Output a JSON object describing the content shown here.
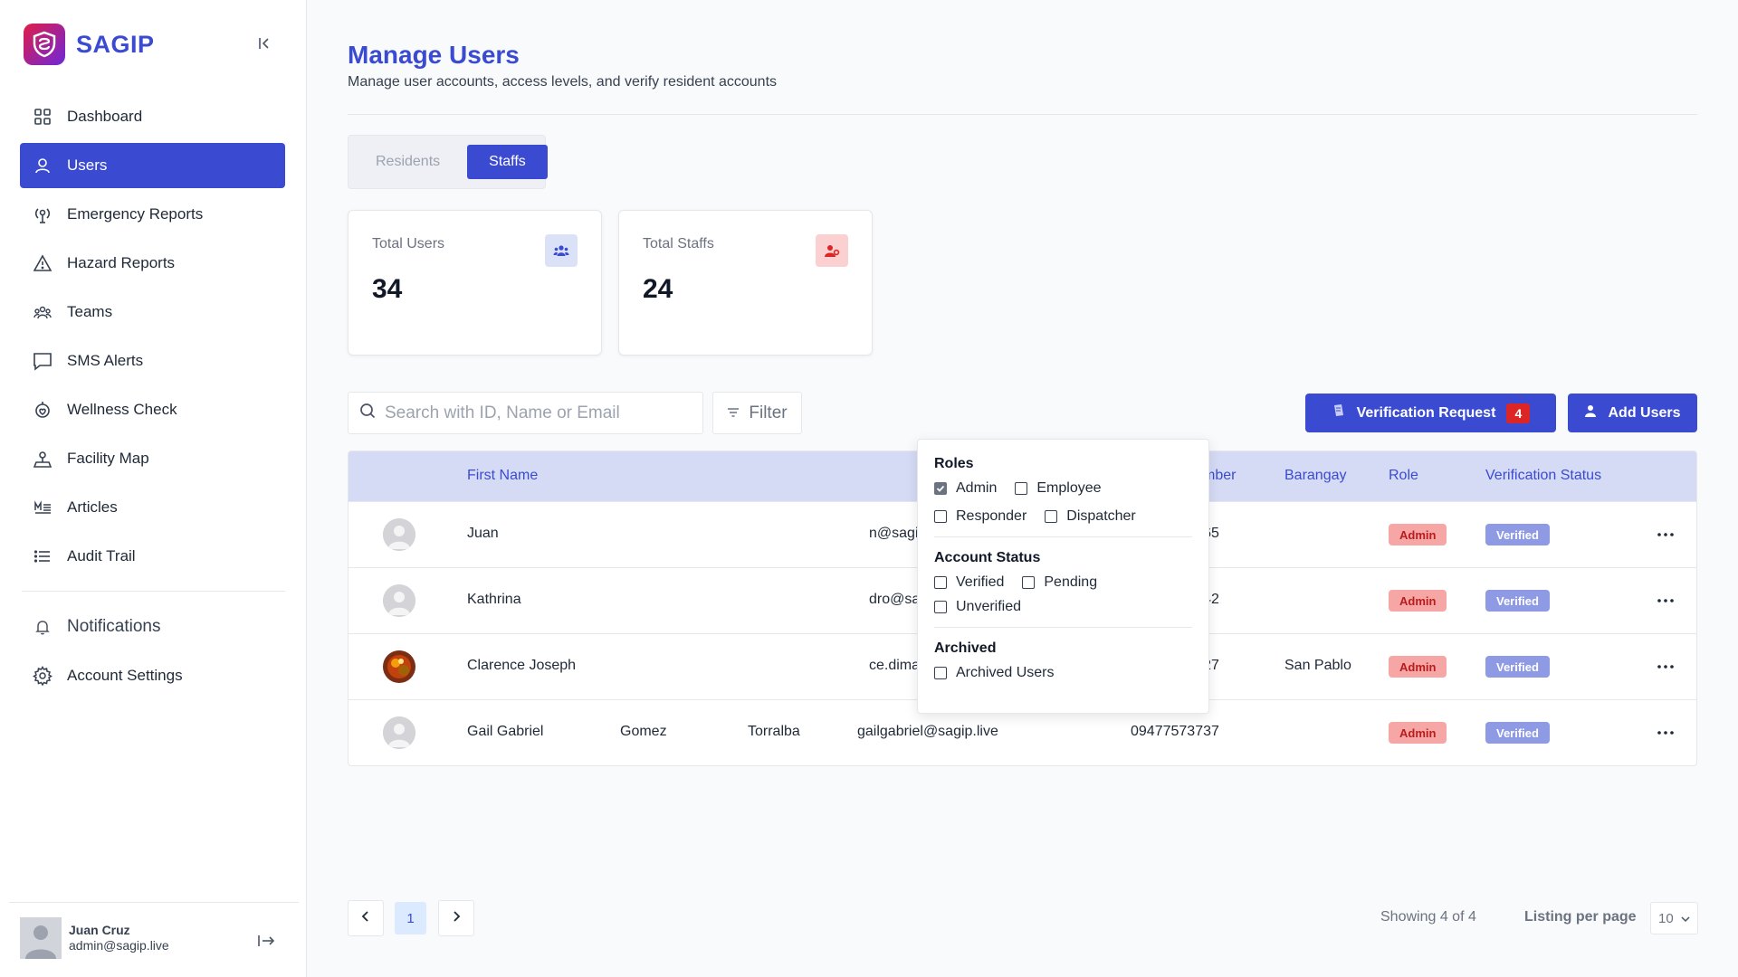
{
  "brand": {
    "name": "SAGIP"
  },
  "sidebar": {
    "items": [
      {
        "label": "Dashboard",
        "icon": "dashboard-icon"
      },
      {
        "label": "Users",
        "icon": "user-icon",
        "active": true
      },
      {
        "label": "Emergency Reports",
        "icon": "location-signal-icon"
      },
      {
        "label": "Hazard Reports",
        "icon": "warning-icon"
      },
      {
        "label": "Teams",
        "icon": "team-icon"
      },
      {
        "label": "SMS Alerts",
        "icon": "chat-icon"
      },
      {
        "label": "Wellness Check",
        "icon": "heart-pulse-icon"
      },
      {
        "label": "Facility Map",
        "icon": "map-pin-icon"
      },
      {
        "label": "Articles",
        "icon": "articles-icon"
      },
      {
        "label": "Audit Trail",
        "icon": "list-icon"
      }
    ],
    "secondary": [
      {
        "label": "Notifications",
        "icon": "bell-icon"
      },
      {
        "label": "Account Settings",
        "icon": "gear-icon"
      }
    ]
  },
  "user": {
    "name": "Juan Cruz",
    "email": "admin@sagip.live"
  },
  "header": {
    "title": "Manage Users",
    "subtitle": "Manage user accounts, access levels, and verify resident accounts"
  },
  "tabs": [
    {
      "label": "Residents",
      "active": false
    },
    {
      "label": "Staffs",
      "active": true
    }
  ],
  "stats": {
    "total_users": {
      "label": "Total Users",
      "value": "34"
    },
    "total_staffs": {
      "label": "Total Staffs",
      "value": "24"
    }
  },
  "search": {
    "placeholder": "Search with ID, Name or Email"
  },
  "filter": {
    "label": "Filter"
  },
  "actions": {
    "verification_label": "Verification Request",
    "verification_count": "4",
    "add_users_label": "Add Users"
  },
  "table": {
    "headers": [
      "First Name",
      "Contact Number",
      "Barangay",
      "Role",
      "Verification Status"
    ],
    "rows": [
      {
        "first_name": "Juan",
        "middle_name": "",
        "last_name": "",
        "email": "n@sagip.live",
        "contact": "09131346465",
        "barangay": "",
        "role": "Admin",
        "status": "Verified"
      },
      {
        "first_name": "Kathrina",
        "middle_name": "",
        "last_name": "",
        "email": "dro@sagip.live",
        "contact": "09673423842",
        "barangay": "",
        "role": "Admin",
        "status": "Verified"
      },
      {
        "first_name": "Clarence Joseph",
        "middle_name": "",
        "last_name": "",
        "email": "ce.dimafelix07@gmail.com",
        "contact": "09774604427",
        "barangay": "San Pablo",
        "role": "Admin",
        "status": "Verified"
      },
      {
        "first_name": "Gail Gabriel",
        "middle_name": "Gomez",
        "last_name": "Torralba",
        "email": "gailgabriel@sagip.live",
        "contact": "09477573737",
        "barangay": "",
        "role": "Admin",
        "status": "Verified"
      }
    ]
  },
  "dropdown": {
    "roles_title": "Roles",
    "roles": [
      {
        "label": "Admin",
        "checked": true
      },
      {
        "label": "Employee",
        "checked": false
      },
      {
        "label": "Responder",
        "checked": false
      },
      {
        "label": "Dispatcher",
        "checked": false
      }
    ],
    "status_title": "Account Status",
    "statuses": [
      {
        "label": "Verified",
        "checked": false
      },
      {
        "label": "Pending",
        "checked": false
      },
      {
        "label": "Unverified",
        "checked": false
      }
    ],
    "archived_title": "Archived",
    "archived": [
      {
        "label": "Archived Users",
        "checked": false
      }
    ]
  },
  "pagination": {
    "current_page": "1",
    "showing": "Showing 4 of 4",
    "listing_label": "Listing per page",
    "per_page": "10"
  },
  "colors": {
    "primary": "#3b4bd1",
    "table_header_bg": "#d5dbf5",
    "role_badge_bg": "#f7a6a6",
    "verified_badge_bg": "#8e9ae3",
    "alert_red": "#dc2626"
  }
}
